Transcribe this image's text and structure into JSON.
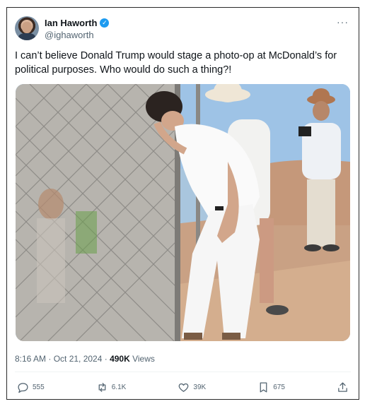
{
  "author": {
    "name": "Ian Haworth",
    "handle": "@ighaworth",
    "verified_mark": "✓"
  },
  "tweet": {
    "text": "I can’t believe Donald Trump would stage a photo-op at McDonald’s for political purposes. Who would do such a thing?!",
    "time": "8:16 AM · Oct 21, 2024 · ",
    "views_count": "490K",
    "views_label": " Views"
  },
  "more_label": "···",
  "actions": {
    "replies": "555",
    "reposts": "6.1K",
    "likes": "39K",
    "bookmarks": "675"
  },
  "icons": [
    "reply-icon",
    "repost-icon",
    "like-icon",
    "bookmark-icon",
    "share-icon",
    "verified-badge-icon"
  ],
  "colors": {
    "accent": "#1d9bf0",
    "muted": "#536471",
    "text": "#0f1419"
  }
}
